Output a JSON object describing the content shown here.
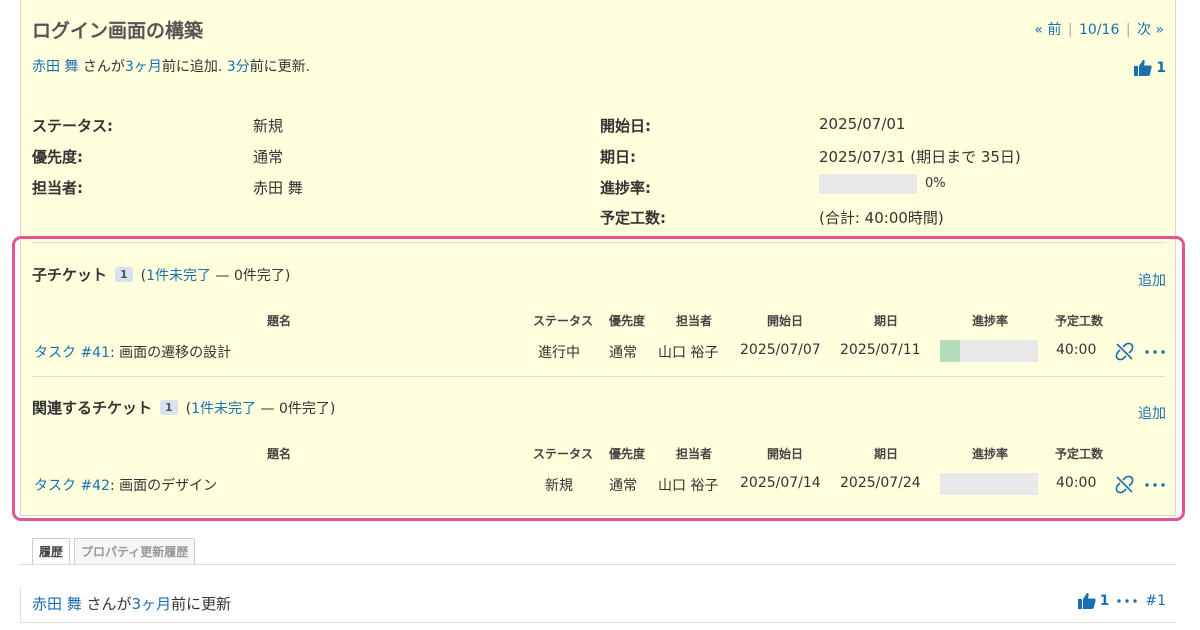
{
  "issue": {
    "title": "ログイン画面の構築",
    "nav": {
      "prev": "« 前",
      "position": "10/16",
      "next": "次 »",
      "divider": "|"
    },
    "author": {
      "name": "赤田 舞",
      "mid1": " さんが",
      "added_ago": "3ヶ月",
      "mid2": "前に追加. ",
      "updated_ago": "3分",
      "mid3": "前に更新."
    },
    "likes": {
      "count": "1"
    },
    "attributes": {
      "status_label": "ステータス:",
      "status": "新規",
      "priority_label": "優先度:",
      "priority": "通常",
      "assignee_label": "担当者:",
      "assignee": "赤田 舞",
      "start_label": "開始日:",
      "start": "2025/07/01",
      "due_label": "期日:",
      "due": "2025/07/31 (期日まで 35日)",
      "progress_label": "進捗率:",
      "progress": "0%",
      "progress_value": 0,
      "estimate_label": "予定工数:",
      "estimate": "(合計: 40:00時間)"
    }
  },
  "subtasks": {
    "title": "子チケット",
    "count": "1",
    "open_link": "1件未完了",
    "summary_prefix": "(",
    "summary_suffix": " — 0件完了)",
    "add": "追加",
    "headers": {
      "subject": "題名",
      "status": "ステータス",
      "priority": "優先度",
      "assignee": "担当者",
      "start": "開始日",
      "due": "期日",
      "progress": "進捗率",
      "estimate": "予定工数"
    },
    "rows": [
      {
        "link": "タスク #41",
        "subject": ": 画面の遷移の設計",
        "status": "進行中",
        "priority": "通常",
        "assignee": "山口 裕子",
        "start": "2025/07/07",
        "due": "2025/07/11",
        "progress": 20,
        "estimate": "40:00"
      }
    ]
  },
  "relations": {
    "title": "関連するチケット",
    "count": "1",
    "open_link": "1件未完了",
    "summary_prefix": "(",
    "summary_suffix": " — 0件完了)",
    "add": "追加",
    "headers": {
      "subject": "題名",
      "status": "ステータス",
      "priority": "優先度",
      "assignee": "担当者",
      "start": "開始日",
      "due": "期日",
      "progress": "進捗率",
      "estimate": "予定工数"
    },
    "rows": [
      {
        "link": "タスク #42",
        "subject": ": 画面のデザイン",
        "status": "新規",
        "priority": "通常",
        "assignee": "山口 裕子",
        "start": "2025/07/14",
        "due": "2025/07/24",
        "progress": 0,
        "estimate": "40:00"
      }
    ]
  },
  "tabs": {
    "history": "履歴",
    "property_history": "プロパティ更新履歴"
  },
  "journal": {
    "author": "赤田 舞",
    "mid": " さんが",
    "ago": "3ヶ月",
    "suffix": "前に更新",
    "likes": "1",
    "number": "#1"
  },
  "colors": {
    "link": "#1a6fb0",
    "highlight": "#e2558f",
    "box": "#ffffdd",
    "progress_fill": "#b3dfb8"
  },
  "icons": {
    "thumbs_up": "thumbs-up-icon",
    "unlink": "unlink-icon",
    "more": "ellipsis-icon"
  }
}
